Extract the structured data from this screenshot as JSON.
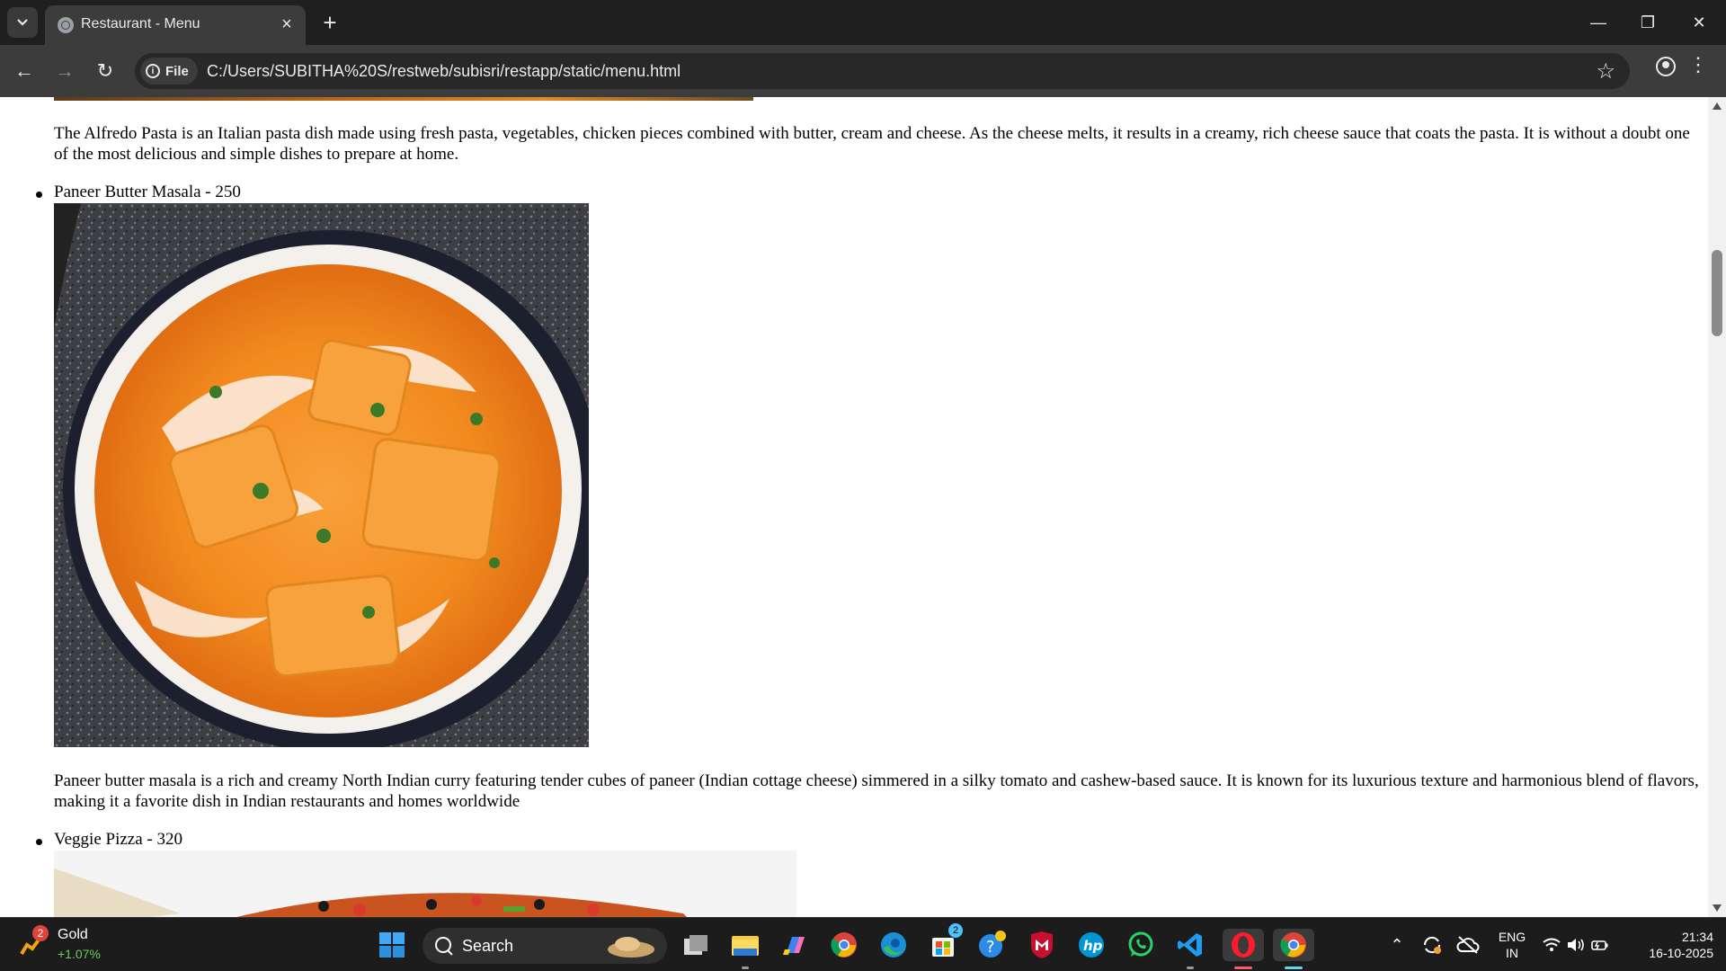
{
  "browser": {
    "tab_title": "Restaurant - Menu",
    "url_chip": "File",
    "url": "C:/Users/SUBITHA%20S/restweb/subisri/restapp/static/menu.html"
  },
  "page": {
    "alfredo_description": "The Alfredo Pasta is an Italian pasta dish made using fresh pasta, vegetables, chicken pieces combined with butter, cream and cheese. As the cheese melts, it results in a creamy, rich cheese sauce that coats the pasta. It is without a doubt one of the most delicious and simple dishes to prepare at home.",
    "items": [
      {
        "label": "Paneer Butter Masala - 250",
        "description": "Paneer butter masala is a rich and creamy North Indian curry featuring tender cubes of paneer (Indian cottage cheese) simmered in a silky tomato and cashew-based sauce. It is known for its luxurious texture and harmonious blend of flavors, making it a favorite dish in Indian restaurants and homes worldwide"
      },
      {
        "label": "Veggie Pizza - 320"
      }
    ]
  },
  "taskbar": {
    "weather_title": "Gold",
    "weather_change": "+1.07%",
    "weather_badge": "2",
    "search_label": "Search",
    "store_badge": "2",
    "lang_line1": "ENG",
    "lang_line2": "IN",
    "time": "21:34",
    "date": "16-10-2025"
  }
}
